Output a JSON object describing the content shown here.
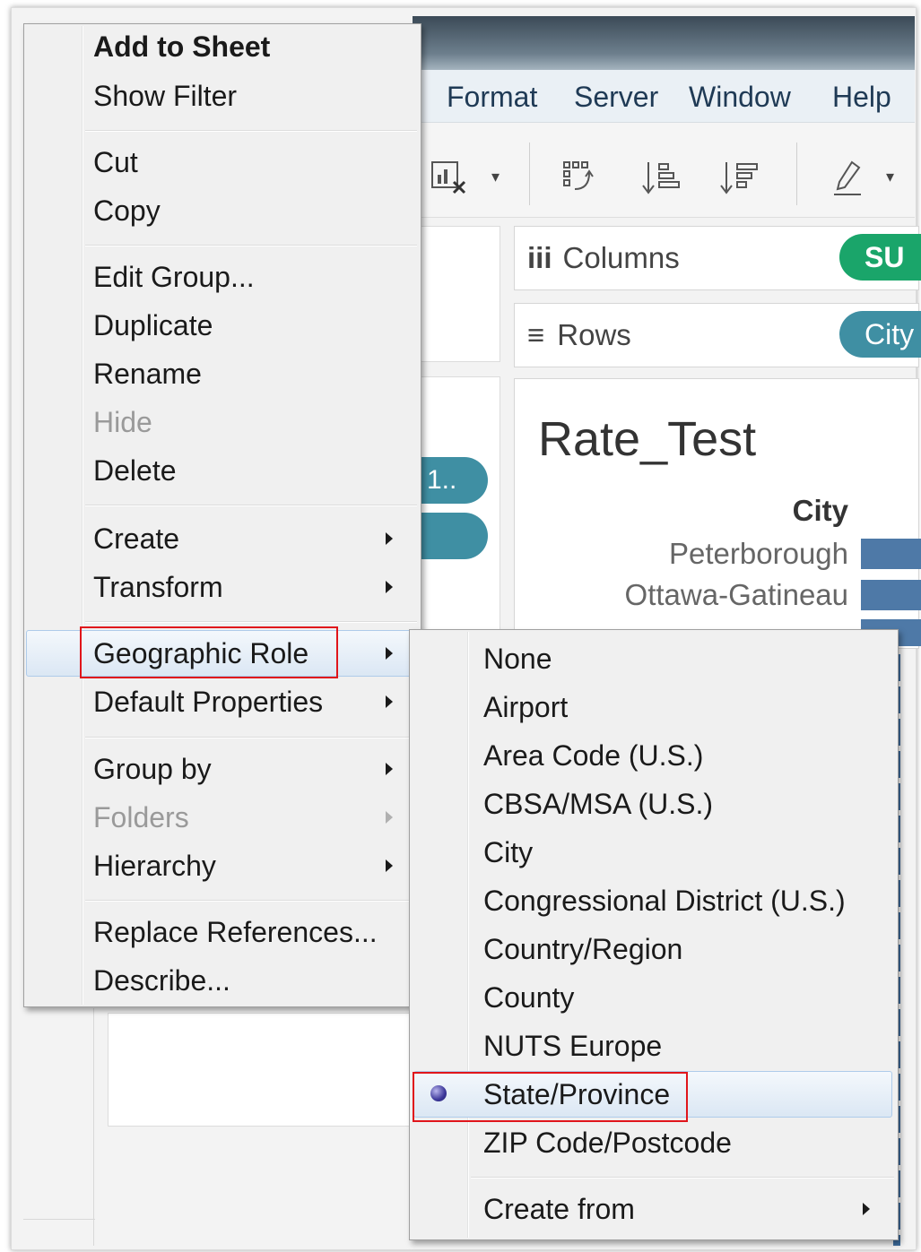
{
  "menubar": {
    "items": [
      "Format",
      "Server",
      "Window",
      "Help"
    ]
  },
  "shelves": {
    "columns_label": "Columns",
    "columns_icon": "iii",
    "columns_pill": "SU",
    "rows_label": "Rows",
    "rows_icon": "≡",
    "rows_pill": "City"
  },
  "data_pane": {
    "pill_text": "1.."
  },
  "view": {
    "title": "Rate_Test",
    "header": "City",
    "rows": [
      "Peterborough",
      "Ottawa-Gatineau"
    ]
  },
  "context_menu": {
    "add_to_sheet": "Add to Sheet",
    "show_filter": "Show Filter",
    "cut": "Cut",
    "copy": "Copy",
    "edit_group": "Edit Group...",
    "duplicate": "Duplicate",
    "rename": "Rename",
    "hide": "Hide",
    "delete": "Delete",
    "create": "Create",
    "transform": "Transform",
    "geographic_role": "Geographic Role",
    "default_properties": "Default Properties",
    "group_by": "Group by",
    "folders": "Folders",
    "hierarchy": "Hierarchy",
    "replace_references": "Replace References...",
    "describe": "Describe..."
  },
  "geographic_submenu": {
    "items": [
      "None",
      "Airport",
      "Area Code (U.S.)",
      "CBSA/MSA (U.S.)",
      "City",
      "Congressional District (U.S.)",
      "Country/Region",
      "County",
      "NUTS Europe",
      "State/Province",
      "ZIP Code/Postcode"
    ],
    "selected": "State/Province",
    "create_from": "Create from"
  },
  "colors": {
    "highlight_box": "#e0151b",
    "pill_green": "#1aa56a",
    "pill_teal": "#3f8fa3",
    "bar_blue": "#4e79a7"
  }
}
